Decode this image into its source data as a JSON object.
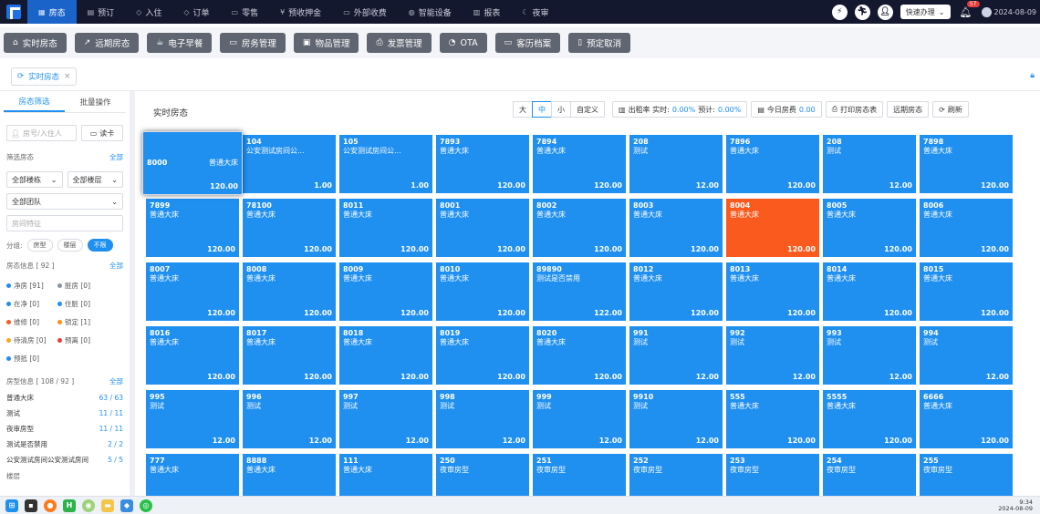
{
  "nav": {
    "items": [
      {
        "label": "房态",
        "icon": "grid-icon",
        "active": true
      },
      {
        "label": "预订",
        "icon": "calendar-icon"
      },
      {
        "label": "入住",
        "icon": "tag-icon"
      },
      {
        "label": "订单",
        "icon": "tag-icon"
      },
      {
        "label": "零售",
        "icon": "shop-icon"
      },
      {
        "label": "预收押金",
        "icon": "money-icon"
      },
      {
        "label": "外部收费",
        "icon": "wallet-icon"
      },
      {
        "label": "智能设备",
        "icon": "bulb-icon"
      },
      {
        "label": "报表",
        "icon": "chart-icon"
      },
      {
        "label": "夜审",
        "icon": "moon-icon"
      }
    ],
    "quick_label": "快速办理",
    "bell_badge": "57",
    "date": "2024-08-09"
  },
  "toolbar": {
    "buttons": [
      {
        "label": "实时房态",
        "icon": "bank-icon"
      },
      {
        "label": "远期房态",
        "icon": "trend-icon"
      },
      {
        "label": "电子早餐",
        "icon": "cup-icon"
      },
      {
        "label": "房务管理",
        "icon": "monitor-icon"
      },
      {
        "label": "物品管理",
        "icon": "box-icon"
      },
      {
        "label": "发票管理",
        "icon": "printer-icon"
      },
      {
        "label": "OTA",
        "icon": "pie-icon"
      },
      {
        "label": "客历档案",
        "icon": "card-icon"
      },
      {
        "label": "预定取消",
        "icon": "file-icon"
      }
    ]
  },
  "tab": {
    "label": "实时房态"
  },
  "sidebar": {
    "tabs": [
      "房态筛选",
      "批量操作"
    ],
    "search_placeholder": "房号/入住人",
    "read_card": "读卡",
    "area_title": "筛选房态",
    "all": "全部",
    "building": "全部楼栋",
    "floor": "全部楼层",
    "team": "全部团队",
    "feature": "房间特征",
    "group_label": "分组:",
    "group_options": [
      "房型",
      "楼层",
      "不限"
    ],
    "status_title": "房态信息 [ 92 ]",
    "statuses": [
      {
        "label": "净房 [91]",
        "color": "#1f8ff0"
      },
      {
        "label": "脏房 [0]",
        "color": "#8a94a6"
      },
      {
        "label": "在净 [0]",
        "color": "#1f8ff0"
      },
      {
        "label": "住脏 [0]",
        "color": "#1f8ff0"
      },
      {
        "label": "维修 [0]",
        "color": "#fa5a1e"
      },
      {
        "label": "锁定 [1]",
        "color": "#fa8c16"
      },
      {
        "label": "待清房 [0]",
        "color": "#f5a623"
      },
      {
        "label": "预离 [0]",
        "color": "#e83b3b"
      },
      {
        "label": "预抵 [0]",
        "color": "#1f8ff0"
      }
    ],
    "type_title": "房型信息 [ 108 / 92 ]",
    "types": [
      {
        "name": "普通大床",
        "count": "63 / 63"
      },
      {
        "name": "测试",
        "count": "11 / 11"
      },
      {
        "name": "夜审房型",
        "count": "11 / 11"
      },
      {
        "name": "测试是否禁用",
        "count": "2 / 2"
      },
      {
        "name": "公安测试房间公安测试房间",
        "count": "5 / 5"
      }
    ],
    "more": "楼层"
  },
  "main": {
    "title": "实时房态",
    "size_options": [
      "大",
      "中",
      "小",
      "自定义"
    ],
    "occupancy_label": "出租率 实时:",
    "occupancy_now": "0.00%",
    "occupancy_forecast_label": "预计:",
    "occupancy_forecast": "0.00%",
    "today_label": "今日房费",
    "today_value": "0.00",
    "print_label": "打印房态表",
    "far_label": "远期房态",
    "refresh_label": "刷新"
  },
  "rooms": [
    {
      "no": "8000",
      "type": "普通大床",
      "price": "120.00",
      "selected": true
    },
    {
      "no": "104",
      "type": "公安测试房间公...",
      "price": "1.00"
    },
    {
      "no": "105",
      "type": "公安测试房间公...",
      "price": "1.00"
    },
    {
      "no": "7893",
      "type": "普通大床",
      "price": "120.00"
    },
    {
      "no": "7894",
      "type": "普通大床",
      "price": "120.00"
    },
    {
      "no": "208",
      "type": "测试",
      "price": "12.00"
    },
    {
      "no": "7896",
      "type": "普通大床",
      "price": "120.00"
    },
    {
      "no": "208",
      "type": "测试",
      "price": "12.00"
    },
    {
      "no": "7898",
      "type": "普通大床",
      "price": "120.00"
    },
    {
      "no": "7899",
      "type": "普通大床",
      "price": "120.00"
    },
    {
      "no": "78100",
      "type": "普通大床",
      "price": "120.00"
    },
    {
      "no": "8011",
      "type": "普通大床",
      "price": "120.00"
    },
    {
      "no": "8001",
      "type": "普通大床",
      "price": "120.00"
    },
    {
      "no": "8002",
      "type": "普通大床",
      "price": "120.00"
    },
    {
      "no": "8003",
      "type": "普通大床",
      "price": "120.00"
    },
    {
      "no": "8004",
      "type": "普通大床",
      "price": "120.00",
      "status": "locked"
    },
    {
      "no": "8005",
      "type": "普通大床",
      "price": "120.00"
    },
    {
      "no": "8006",
      "type": "普通大床",
      "price": "120.00"
    },
    {
      "no": "8007",
      "type": "普通大床",
      "price": "120.00"
    },
    {
      "no": "8008",
      "type": "普通大床",
      "price": "120.00"
    },
    {
      "no": "8009",
      "type": "普通大床",
      "price": "120.00"
    },
    {
      "no": "8010",
      "type": "普通大床",
      "price": "120.00"
    },
    {
      "no": "89890",
      "type": "测试是否禁用",
      "price": "122.00"
    },
    {
      "no": "8012",
      "type": "普通大床",
      "price": "120.00"
    },
    {
      "no": "8013",
      "type": "普通大床",
      "price": "120.00"
    },
    {
      "no": "8014",
      "type": "普通大床",
      "price": "120.00"
    },
    {
      "no": "8015",
      "type": "普通大床",
      "price": "120.00"
    },
    {
      "no": "8016",
      "type": "普通大床",
      "price": "120.00"
    },
    {
      "no": "8017",
      "type": "普通大床",
      "price": "120.00"
    },
    {
      "no": "8018",
      "type": "普通大床",
      "price": "120.00"
    },
    {
      "no": "8019",
      "type": "普通大床",
      "price": "120.00"
    },
    {
      "no": "8020",
      "type": "普通大床",
      "price": "120.00"
    },
    {
      "no": "991",
      "type": "测试",
      "price": "12.00"
    },
    {
      "no": "992",
      "type": "测试",
      "price": "12.00"
    },
    {
      "no": "993",
      "type": "测试",
      "price": "12.00"
    },
    {
      "no": "994",
      "type": "测试",
      "price": "12.00"
    },
    {
      "no": "995",
      "type": "测试",
      "price": "12.00"
    },
    {
      "no": "996",
      "type": "测试",
      "price": "12.00"
    },
    {
      "no": "997",
      "type": "测试",
      "price": "12.00"
    },
    {
      "no": "998",
      "type": "测试",
      "price": "12.00"
    },
    {
      "no": "999",
      "type": "测试",
      "price": "12.00"
    },
    {
      "no": "9910",
      "type": "测试",
      "price": "12.00"
    },
    {
      "no": "555",
      "type": "普通大床",
      "price": "120.00"
    },
    {
      "no": "5555",
      "type": "普通大床",
      "price": "120.00"
    },
    {
      "no": "6666",
      "type": "普通大床",
      "price": "120.00"
    },
    {
      "no": "777",
      "type": "普通大床",
      "price": "120.00"
    },
    {
      "no": "8888",
      "type": "普通大床",
      "price": "120.00"
    },
    {
      "no": "111",
      "type": "普通大床",
      "price": "120.00"
    },
    {
      "no": "250",
      "type": "夜审房型",
      "price": "120.00"
    },
    {
      "no": "251",
      "type": "夜审房型",
      "price": "120.00"
    },
    {
      "no": "252",
      "type": "夜审房型",
      "price": "120.00"
    },
    {
      "no": "253",
      "type": "夜审房型",
      "price": "120.00"
    },
    {
      "no": "254",
      "type": "夜审房型",
      "price": "120.00"
    },
    {
      "no": "255",
      "type": "夜审房型",
      "price": "120.00"
    }
  ],
  "taskbar": {
    "time": "9:34",
    "date": "2024-08-09"
  }
}
